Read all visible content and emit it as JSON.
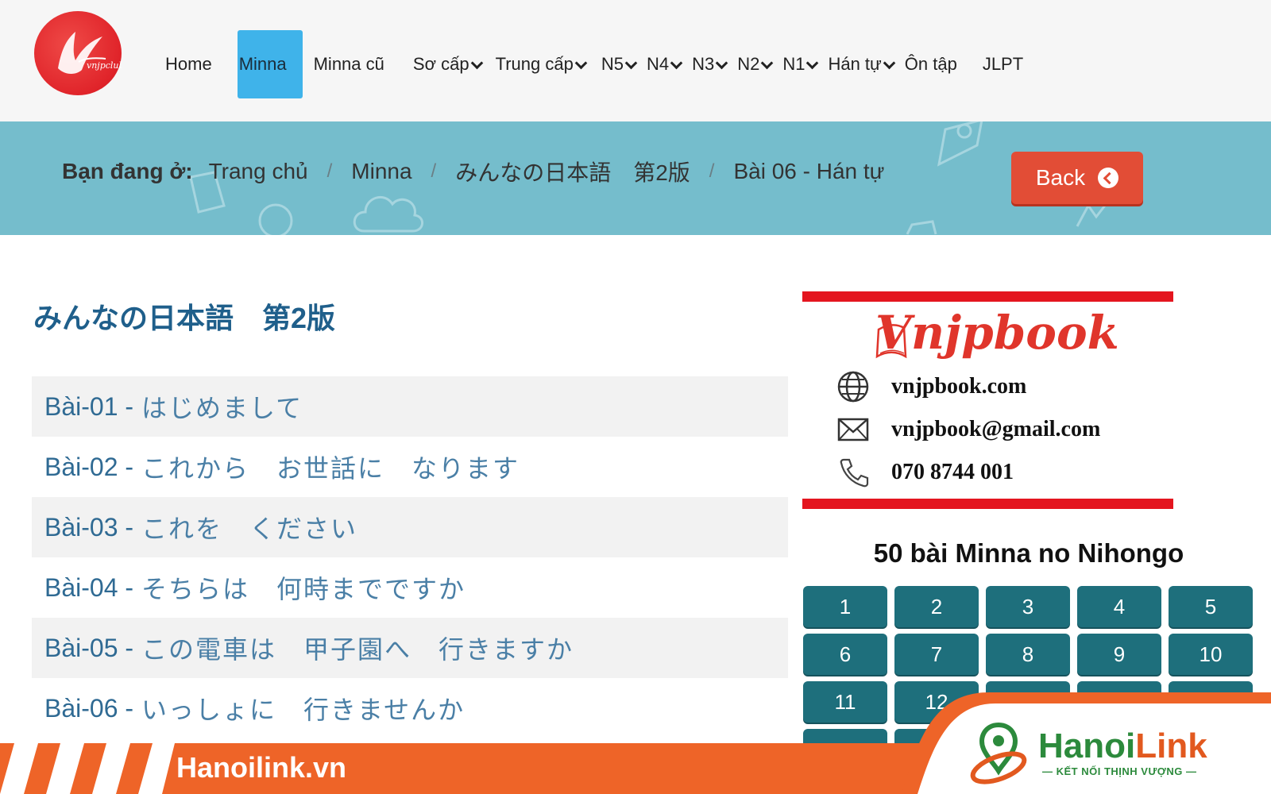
{
  "header": {
    "logo_icon": "vnjpclub-crane-logo",
    "nav": [
      {
        "label": "Home",
        "dropdown": false,
        "active": false
      },
      {
        "label": "Minna",
        "dropdown": false,
        "active": true
      },
      {
        "label": "Minna cũ",
        "dropdown": false,
        "active": false
      },
      {
        "label": "Sơ cấp",
        "dropdown": true,
        "active": false
      },
      {
        "label": "Trung cấp",
        "dropdown": true,
        "active": false
      },
      {
        "label": "N5",
        "dropdown": true,
        "active": false
      },
      {
        "label": "N4",
        "dropdown": true,
        "active": false
      },
      {
        "label": "N3",
        "dropdown": true,
        "active": false
      },
      {
        "label": "N2",
        "dropdown": true,
        "active": false
      },
      {
        "label": "N1",
        "dropdown": true,
        "active": false
      },
      {
        "label": "Hán tự",
        "dropdown": true,
        "active": false
      },
      {
        "label": "Ôn tập",
        "dropdown": false,
        "active": false
      },
      {
        "label": "JLPT",
        "dropdown": false,
        "active": false
      }
    ],
    "active_color": "#3fb3ea"
  },
  "breadcrumb": {
    "lead": "Bạn đang ở:",
    "items": [
      "Trang chủ",
      "Minna",
      "みんなの日本語　第2版",
      "Bài 06 - Hán tự"
    ],
    "separator": "/",
    "back_label": "Back"
  },
  "main": {
    "title": "みんなの日本語　第2版",
    "lessons": [
      {
        "num": "Bài-01 -",
        "title": "はじめまして"
      },
      {
        "num": "Bài-02 -",
        "title": "これから　お世話に　なります"
      },
      {
        "num": "Bài-03 -",
        "title": "これを　ください"
      },
      {
        "num": "Bài-04 -",
        "title": "そちらは　何時までですか"
      },
      {
        "num": "Bài-05 -",
        "title": "この電車は　甲子園へ　行きますか"
      },
      {
        "num": "Bài-06 -",
        "title": "いっしょに　行きませんか"
      }
    ]
  },
  "sidebar": {
    "brand": "Vnjpbook",
    "contacts": [
      {
        "icon": "globe-icon",
        "text": "vnjpbook.com"
      },
      {
        "icon": "mail-icon",
        "text": "vnjpbook@gmail.com"
      },
      {
        "icon": "phone-icon",
        "text": "070 8744 001"
      }
    ],
    "grid_title": "50 bài Minna no Nihongo",
    "lesson_numbers": [
      "1",
      "2",
      "3",
      "4",
      "5",
      "6",
      "7",
      "8",
      "9",
      "10",
      "11",
      "12"
    ]
  },
  "watermark": {
    "site": "Hanoilink.vn",
    "brand_part1": "Hanoi",
    "brand_part2": "Link",
    "slogan": "KẾT NỐI THỊNH VƯỢNG",
    "color": "#ee6428"
  }
}
